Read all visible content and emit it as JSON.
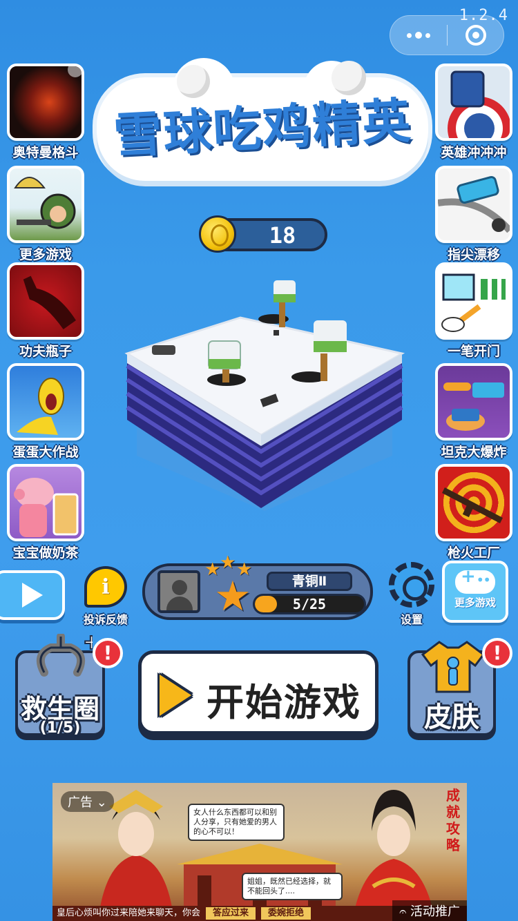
{
  "version": "1.2.4",
  "title": "雪球吃鸡精英",
  "coins": "18",
  "left_apps": [
    {
      "label": "奥特曼格斗",
      "icon": "ultraman-icon",
      "color": "#2a1210",
      "accent": "#d94419"
    },
    {
      "label": "更多游戏",
      "icon": "parachute-soldier-icon",
      "color": "#e5f1f5",
      "accent": "#4e7d36"
    },
    {
      "label": "功夫瓶子",
      "icon": "cola-bottle-icon",
      "color": "#b3151b",
      "accent": "#6e0d0f"
    },
    {
      "label": "蛋蛋大作战",
      "icon": "rubber-chicken-icon",
      "color": "#3b8fe4",
      "accent": "#f6d323"
    },
    {
      "label": "宝宝做奶茶",
      "icon": "peppa-pig-icon",
      "color": "#a36fd1",
      "accent": "#f4a6b8"
    }
  ],
  "right_apps": [
    {
      "label": "英雄冲冲冲",
      "icon": "captain-shield-icon",
      "color": "#2c5aa8",
      "accent": "#d9282f"
    },
    {
      "label": "指尖漂移",
      "icon": "drift-car-icon",
      "color": "#f2f2f2",
      "accent": "#39b4e5"
    },
    {
      "label": "一笔开门",
      "icon": "door-drawing-icon",
      "color": "#ffffff",
      "accent": "#36a54a"
    },
    {
      "label": "坦克大爆炸",
      "icon": "tank-icon",
      "color": "#7540a4",
      "accent": "#f4a42a"
    },
    {
      "label": "枪火工厂",
      "icon": "rifle-target-icon",
      "color": "#d11f1b",
      "accent": "#f3b21c"
    }
  ],
  "feedback_label": "投诉反馈",
  "rank": {
    "name": "青铜Ⅱ",
    "progress_text": "5/25",
    "progress": 0.2
  },
  "settings_label": "设置",
  "more_games_label": "更多游戏",
  "lifebuoy": {
    "label": "救生圈",
    "count": "(1/5)",
    "badge": "!"
  },
  "start_label": "开始游戏",
  "skin": {
    "label": "皮肤",
    "badge": "!"
  },
  "ad": {
    "tag": "广告",
    "bubble1": "女人什么东西都可以和别人分享，只有她爱的男人的心不可以！",
    "bubble2": "姐姐，既然已经选择，就不能回头了....",
    "side_title": "成就攻略",
    "bottom_text": "皇后心烦叫你过来陪她来聊天，你会",
    "btn1": "答应过来",
    "btn2": "委婉拒绝",
    "promo": "活动推广"
  },
  "colors": {
    "background": "#3a9aea",
    "outline": "#1d2b45",
    "coin": "#f3c20c",
    "badge": "#e8323a"
  }
}
